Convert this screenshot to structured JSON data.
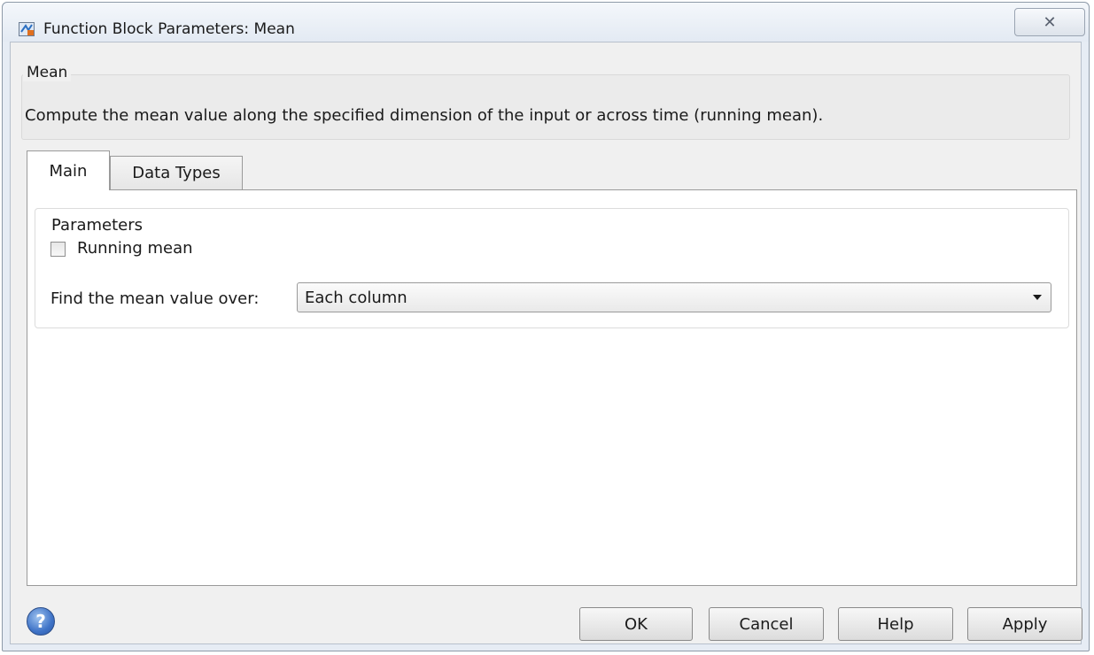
{
  "window": {
    "title": "Function Block Parameters: Mean",
    "close_glyph": "✕"
  },
  "description": {
    "group_title": "Mean",
    "text": "Compute the mean value along the specified dimension of the input or across time (running mean)."
  },
  "tabs": [
    {
      "label": "Main",
      "selected": true
    },
    {
      "label": "Data Types",
      "selected": false
    }
  ],
  "parameters": {
    "group_title": "Parameters",
    "running_mean": {
      "label": "Running mean",
      "checked": false
    },
    "mean_over": {
      "label": "Find the mean value over:",
      "value": "Each column"
    }
  },
  "footer": {
    "help_icon_glyph": "?",
    "buttons": {
      "ok": "OK",
      "cancel": "Cancel",
      "help": "Help",
      "apply": "Apply"
    }
  },
  "colors": {
    "window_frame": "#e6ecf4",
    "client_bg": "#f0f0f0",
    "help_icon_blue": "#3f73c7"
  }
}
